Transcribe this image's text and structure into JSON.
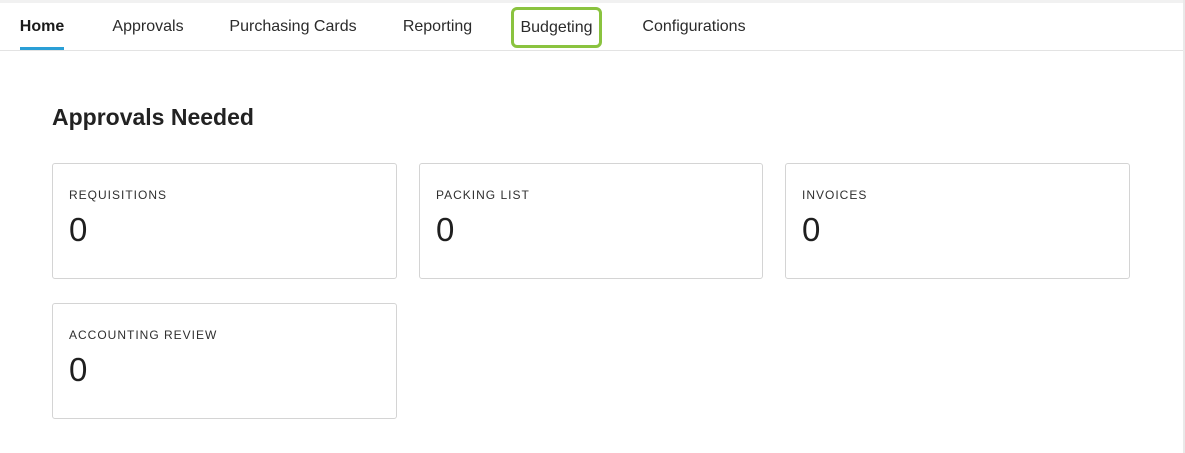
{
  "nav": {
    "tabs": [
      {
        "label": "Home",
        "active": true
      },
      {
        "label": "Approvals",
        "active": false
      },
      {
        "label": "Purchasing Cards",
        "active": false
      },
      {
        "label": "Reporting",
        "active": false
      },
      {
        "label": "Budgeting",
        "active": false,
        "highlighted": true
      },
      {
        "label": "Configurations",
        "active": false
      }
    ],
    "active_indicator_color": "#2a9fd6",
    "highlight_color": "#8ac33f"
  },
  "approvals": {
    "title": "Approvals Needed",
    "cards": [
      {
        "label": "REQUISITIONS",
        "value": "0"
      },
      {
        "label": "PACKING LIST",
        "value": "0"
      },
      {
        "label": "INVOICES",
        "value": "0"
      },
      {
        "label": "ACCOUNTING REVIEW",
        "value": "0"
      }
    ]
  }
}
